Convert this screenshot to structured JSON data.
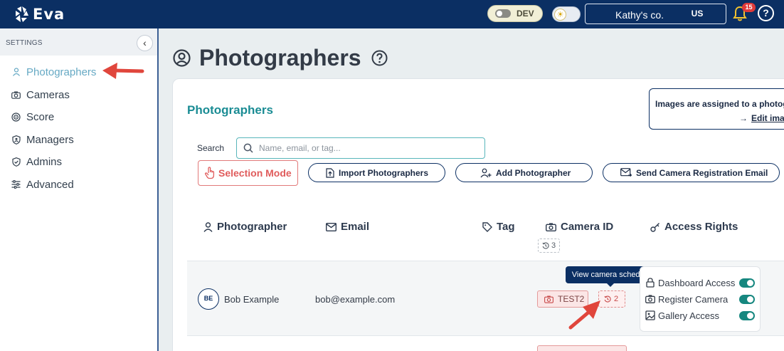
{
  "topbar": {
    "logo_text": "Eva",
    "env_label": "DEV",
    "account_name": "Kathy's co.",
    "region": "US",
    "notification_count": "15",
    "help_label": "?"
  },
  "sidebar": {
    "section_label": "SETTINGS",
    "collapse_label": "‹",
    "items": [
      {
        "label": "Photographers",
        "icon": "user-icon",
        "active": true
      },
      {
        "label": "Cameras",
        "icon": "camera-icon"
      },
      {
        "label": "Score",
        "icon": "target-icon"
      },
      {
        "label": "Managers",
        "icon": "shield-user-icon"
      },
      {
        "label": "Admins",
        "icon": "shield-check-icon"
      },
      {
        "label": "Advanced",
        "icon": "sliders-icon"
      }
    ]
  },
  "page": {
    "title": "Photographers",
    "card_title": "Photographers",
    "info_line1": "Images are assigned to a photographer",
    "info_line2": "Edit images"
  },
  "search": {
    "label": "Search",
    "placeholder": "Name, email, or tag..."
  },
  "actions": {
    "selection_mode": "Selection Mode",
    "import": "Import Photographers",
    "add": "Add Photographer",
    "send_email": "Send Camera Registration Email"
  },
  "table": {
    "headers": {
      "photographer": "Photographer",
      "email": "Email",
      "tag": "Tag",
      "camera_id": "Camera ID",
      "access_rights": "Access Rights"
    },
    "camera_schedule_total": "3",
    "rows": [
      {
        "initials": "BE",
        "name": "Bob Example",
        "email": "bob@example.com",
        "camera": "TEST2",
        "schedule_count": "2",
        "access": [
          {
            "label": "Dashboard Access",
            "enabled": true
          },
          {
            "label": "Register Camera",
            "enabled": true
          },
          {
            "label": "Gallery Access",
            "enabled": true
          }
        ]
      }
    ]
  },
  "tooltip": {
    "text": "View camera schedule"
  },
  "colors": {
    "brand_navy": "#0b2f63",
    "accent_teal": "#1a8c94",
    "alert_red": "#e05c5c",
    "toggle_on": "#16877f",
    "annotation_arrow": "#e0463c"
  }
}
